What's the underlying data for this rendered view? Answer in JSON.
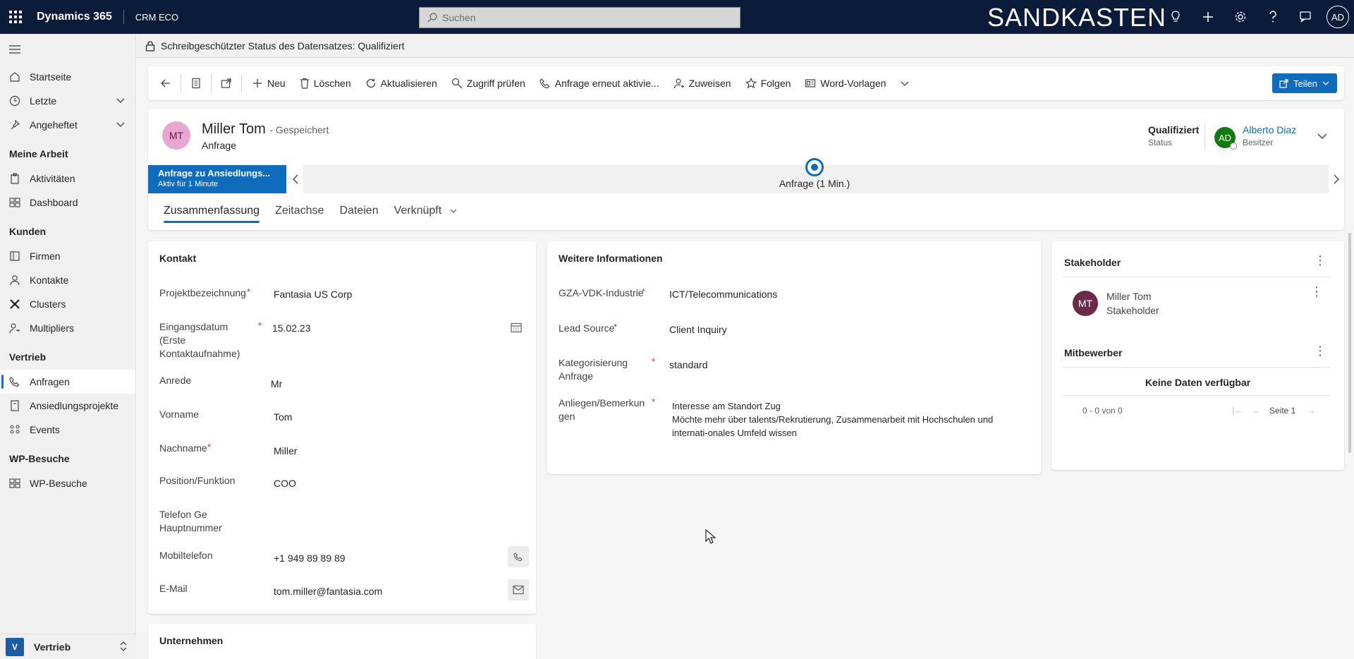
{
  "topbar": {
    "app_name": "Dynamics 365",
    "module": "CRM ECO",
    "search_placeholder": "Suchen",
    "sandbox_label": "SANDKASTEN",
    "user_initials": "AD"
  },
  "sidebar": {
    "items_top": [
      {
        "label": "Startseite",
        "icon": "home-icon"
      },
      {
        "label": "Letzte",
        "icon": "clock-icon"
      },
      {
        "label": "Angeheftet",
        "icon": "pin-icon"
      }
    ],
    "groups": [
      {
        "title": "Meine Arbeit",
        "items": [
          {
            "label": "Aktivitäten",
            "icon": "clipboard-icon"
          },
          {
            "label": "Dashboard",
            "icon": "dashboard-icon"
          }
        ]
      },
      {
        "title": "Kunden",
        "items": [
          {
            "label": "Firmen",
            "icon": "building-icon"
          },
          {
            "label": "Kontakte",
            "icon": "person-icon"
          },
          {
            "label": "Clusters",
            "icon": "cluster-icon"
          },
          {
            "label": "Multipliers",
            "icon": "person-key-icon"
          }
        ]
      },
      {
        "title": "Vertrieb",
        "items": [
          {
            "label": "Anfragen",
            "icon": "phone-person-icon"
          },
          {
            "label": "Ansiedlungsprojekte",
            "icon": "document-icon"
          },
          {
            "label": "Events",
            "icon": "people-icon"
          }
        ]
      },
      {
        "title": "WP-Besuche",
        "items": [
          {
            "label": "WP-Besuche",
            "icon": "dashboard-icon"
          }
        ]
      }
    ],
    "area_badge": "V",
    "area_label": "Vertrieb"
  },
  "readonly_notice": "Schreibgeschützter Status des Datensatzes: Qualifiziert",
  "commands": {
    "new": "Neu",
    "delete": "Löschen",
    "refresh": "Aktualisieren",
    "check_access": "Zugriff prüfen",
    "reactivate": "Anfrage erneut aktivie...",
    "assign": "Zuweisen",
    "follow": "Folgen",
    "word_templates": "Word-Vorlagen",
    "share": "Teilen"
  },
  "record": {
    "initials": "MT",
    "name": "Miller Tom",
    "saved": "- Gespeichert",
    "entity": "Anfrage",
    "status_value": "Qualifiziert",
    "status_label": "Status",
    "owner_initials": "AD",
    "owner_name": "Alberto Diaz",
    "owner_label": "Besitzer"
  },
  "bpf": {
    "active_title": "Anfrage zu Ansiedlungs...",
    "active_sub": "Aktiv für 1 Minute",
    "stage_label": "Anfrage  (1 Min.)"
  },
  "tabs": [
    "Zusammenfassung",
    "Zeitachse",
    "Dateien",
    "Verknüpft"
  ],
  "kontakt": {
    "title": "Kontakt",
    "fields": [
      {
        "label": "Projektbezeichnung",
        "value": "Fantasia US Corp"
      },
      {
        "label": "Eingangsdatum (Erste Kontaktaufnahme)",
        "value": "15.02.23"
      },
      {
        "label": "Anrede",
        "value": "Mr"
      },
      {
        "label": "Vorname",
        "value": "Tom"
      },
      {
        "label": "Nachname",
        "value": "Miller"
      },
      {
        "label": "Position/Funktion",
        "value": "COO"
      },
      {
        "label": "Telefon Ge Hauptnummer",
        "value": ""
      },
      {
        "label": "Mobiltelefon",
        "value": "+1 949 89 89 89"
      },
      {
        "label": "E-Mail",
        "value": "tom.miller@fantasia.com"
      }
    ],
    "required_mark": "*"
  },
  "unternehmen": {
    "title": "Unternehmen"
  },
  "weitere": {
    "title": "Weitere Informationen",
    "fields": [
      {
        "label": "GZA-VDK-Industrie",
        "value": "ICT/Telecommunications"
      },
      {
        "label": "Lead Source",
        "value": "Client Inquiry"
      },
      {
        "label": "Kategorisierung Anfrage",
        "value": "standard"
      },
      {
        "label": "Anliegen/Bemerkun gen",
        "value_line1": "Interesse am Standort Zug",
        "value_line2": "Möchte mehr über talents/Rekrutierung, Zusammenarbeit mit Hochschulen und",
        "value_line3": "internati-onales Umfeld wissen"
      }
    ]
  },
  "stakeholder": {
    "title": "Stakeholder",
    "item_initials": "MT",
    "item_name": "Miller Tom",
    "item_role": "Stakeholder",
    "competitors_title": "Mitbewerber",
    "no_data": "Keine Daten verfügbar",
    "paging_count": "0 - 0 von 0",
    "paging_page": "Seite 1"
  }
}
